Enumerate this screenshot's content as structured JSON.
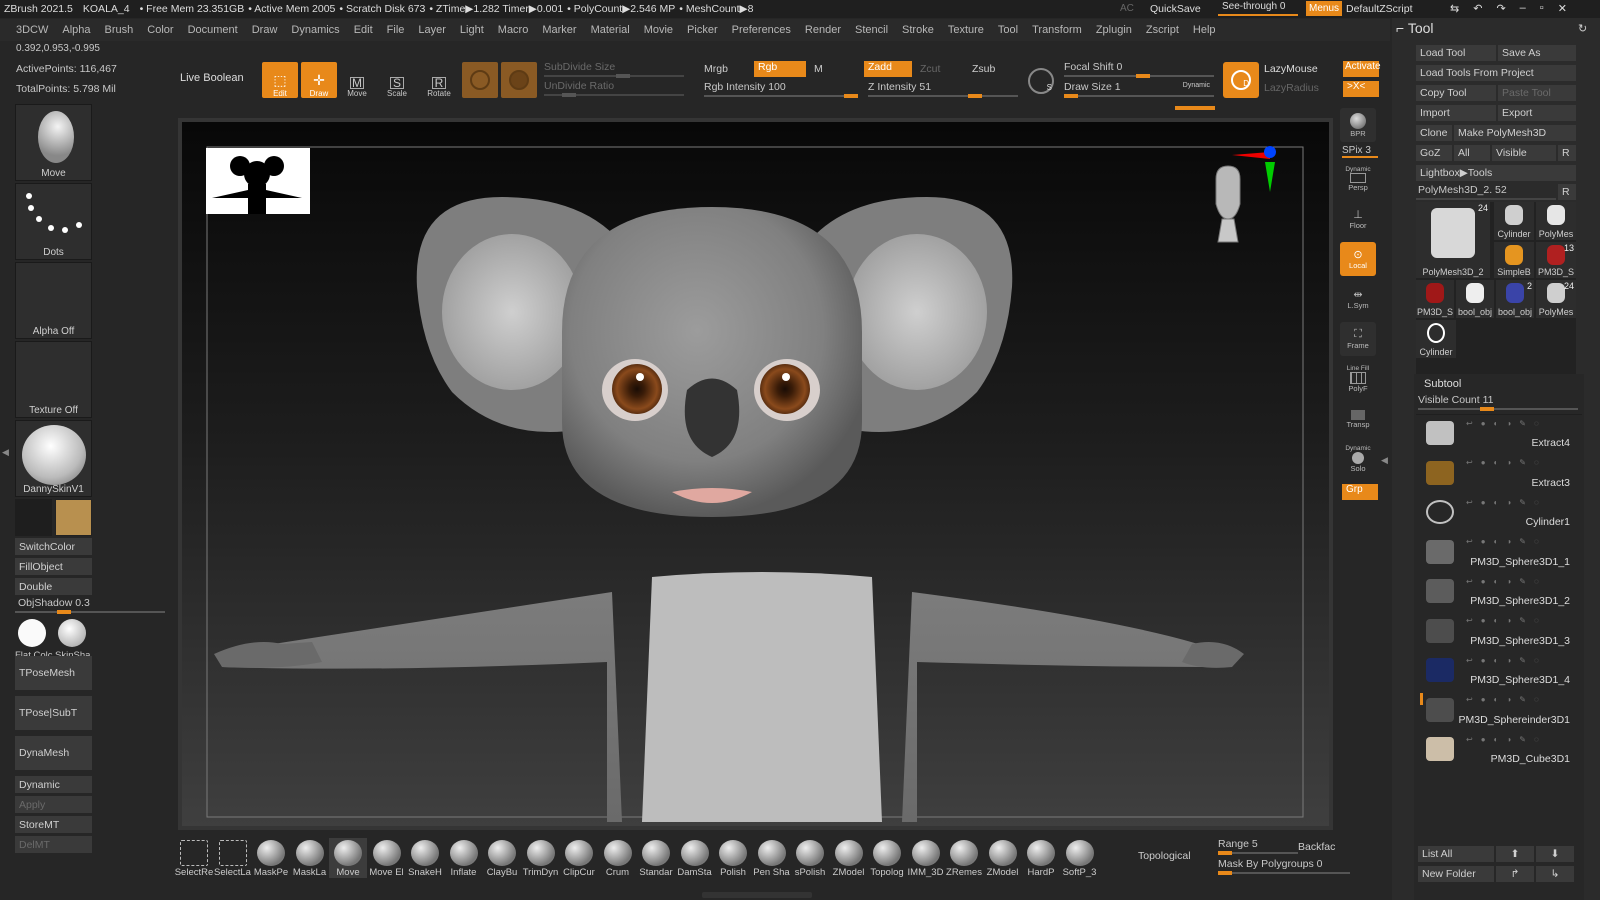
{
  "titlebar": {
    "app": "ZBrush 2021.5",
    "doc": "KOALA_4",
    "free_mem": "• Free Mem 23.351GB",
    "active_mem": "• Active Mem 2005",
    "scratch": "• Scratch Disk 673",
    "ztime": "• ZTime▶1.282 Timer▶0.001",
    "polycount": "• PolyCount▶2.546 MP",
    "meshcount": "• MeshCount▶8",
    "ac": "AC",
    "quicksave": "QuickSave",
    "seethrough": "See-through  0",
    "menus": "Menus",
    "script": "DefaultZScript"
  },
  "menu": [
    "3DCW",
    "Alpha",
    "Brush",
    "Color",
    "Document",
    "Draw",
    "Dynamics",
    "Edit",
    "File",
    "Layer",
    "Light",
    "Macro",
    "Marker",
    "Material",
    "Movie",
    "Picker",
    "Preferences",
    "Render",
    "Stencil",
    "Stroke",
    "Texture",
    "Tool",
    "Transform",
    "Zplugin",
    "Zscript",
    "Help"
  ],
  "left": {
    "coords": "0.392,0.953,-0.995",
    "active_points": "ActivePoints: 116,467",
    "total_points": "TotalPoints: 5.798 Mil",
    "move": "Move",
    "dots": "Dots",
    "alpha": "Alpha Off",
    "texture": "Texture Off",
    "material": "DannySkinV1",
    "switchcolor": "SwitchColor",
    "fillobject": "FillObject",
    "double": "Double",
    "objshadow": "ObjShadow 0.3",
    "flatcolor": "Flat Colc",
    "skinshade": "SkinSha",
    "tposemesh": "TPoseMesh",
    "tposesubt": "TPose|SubT",
    "dynamesh": "DynaMesh",
    "dynamic": "Dynamic",
    "apply": "Apply",
    "storemt": "StoreMT",
    "delmt": "DelMT",
    "material_color": "#b8904f"
  },
  "toolbar": {
    "live_boolean": "Live Boolean",
    "edit": "Edit",
    "draw": "Draw",
    "move": "Move",
    "scale": "Scale",
    "rotate": "Rotate",
    "subdivide": "SubDivide Size",
    "undivide": "UnDivide Ratio",
    "mrgb": "Mrgb",
    "rgb": "Rgb",
    "m": "M",
    "rgb_intensity": "Rgb Intensity 100",
    "zadd": "Zadd",
    "zcut": "Zcut",
    "zsub": "Zsub",
    "z_intensity": "Z Intensity 51",
    "focal_shift": "Focal Shift 0",
    "draw_size": "Draw Size 1",
    "dynamic": "Dynamic",
    "lazymouse": "LazyMouse",
    "lazyradius": "LazyRadius",
    "activate": "Activate",
    "xc": ">X<"
  },
  "rightshelf": {
    "bpr": "BPR",
    "spix": "SPix 3",
    "persp": "Persp",
    "dynamic": "Dynamic",
    "floor": "Floor",
    "local": "Local",
    "lsym": "L.Sym",
    "frame": "Frame",
    "linefill": "Line Fill",
    "polyf": "PolyF",
    "transp": "Transp",
    "dynamic2": "Dynamic",
    "solo": "Solo",
    "grp": "Grp"
  },
  "tool": {
    "title": "Tool",
    "load_tool": "Load Tool",
    "save_as": "Save As",
    "load_project": "Load Tools From Project",
    "copy_tool": "Copy Tool",
    "paste_tool": "Paste Tool",
    "import": "Import",
    "export": "Export",
    "clone": "Clone",
    "make_polymesh": "Make PolyMesh3D",
    "goz": "GoZ",
    "all": "All",
    "visible": "Visible",
    "r": "R",
    "lightbox": "Lightbox▶Tools",
    "current": "PolyMesh3D_2. 52",
    "thumbs": [
      {
        "name": "PolyMesh3D_2",
        "count": "24"
      },
      {
        "name": "Cylinder",
        "count": ""
      },
      {
        "name": "PolyMes",
        "count": ""
      },
      {
        "name": "SimpleB",
        "count": ""
      },
      {
        "name": "PM3D_S",
        "count": "13"
      },
      {
        "name": "PM3D_S",
        "count": ""
      },
      {
        "name": "bool_obj",
        "count": ""
      },
      {
        "name": "bool_obj",
        "count": "2"
      },
      {
        "name": "PolyMes",
        "count": "24"
      },
      {
        "name": "Cylinder",
        "count": ""
      }
    ]
  },
  "subtool": {
    "title": "Subtool",
    "visible_count": "Visible Count 11",
    "items": [
      "Extract4",
      "Extract3",
      "Cylinder1",
      "PM3D_Sphere3D1_1",
      "PM3D_Sphere3D1_2",
      "PM3D_Sphere3D1_3",
      "PM3D_Sphere3D1_4",
      "PM3D_Sphereinder3D1",
      "PM3D_Cube3D1"
    ],
    "list_all": "List All",
    "new_folder": "New Folder"
  },
  "bottom": {
    "brushes": [
      "SelectRe",
      "SelectLa",
      "MaskPe",
      "MaskLa",
      "Move",
      "Move El",
      "SnakeH",
      "Inflate",
      "ClayBu",
      "TrimDyn",
      "ClipCur",
      "Crum",
      "Standar",
      "DamSta",
      "Polish",
      "Pen Sha",
      "sPolish",
      "ZModel",
      "Topolog",
      "IMM_3D",
      "ZRemes",
      "ZModel",
      "HardP",
      "SoftP_3"
    ],
    "topological": "Topological",
    "range": "Range 5",
    "backface": "Backfac",
    "mask_polygroups": "Mask By Polygroups 0"
  }
}
